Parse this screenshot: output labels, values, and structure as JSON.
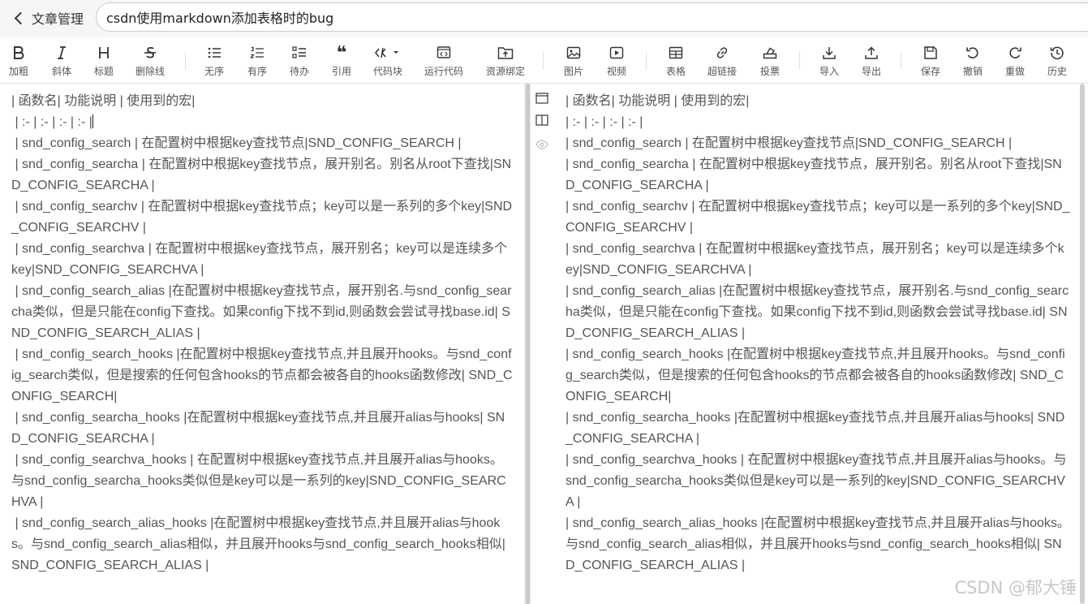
{
  "header": {
    "back_label": "文章管理",
    "title_value": "csdn使用markdown添加表格时的bug"
  },
  "toolbar": [
    {
      "icon": "bold-icon",
      "label": "加粗"
    },
    {
      "icon": "italic-icon",
      "label": "斜体"
    },
    {
      "icon": "heading-icon",
      "label": "标题"
    },
    {
      "icon": "strikethrough-icon",
      "label": "删除线"
    },
    {
      "icon": "unordered-list-icon",
      "label": "无序"
    },
    {
      "icon": "ordered-list-icon",
      "label": "有序"
    },
    {
      "icon": "todo-list-icon",
      "label": "待办"
    },
    {
      "icon": "quote-icon",
      "label": "引用"
    },
    {
      "icon": "code-block-icon",
      "label": "代码块"
    },
    {
      "icon": "run-code-icon",
      "label": "运行代码"
    },
    {
      "icon": "resource-bind-icon",
      "label": "资源绑定"
    },
    {
      "icon": "image-icon",
      "label": "图片"
    },
    {
      "icon": "video-icon",
      "label": "视频"
    },
    {
      "icon": "table-icon",
      "label": "表格"
    },
    {
      "icon": "link-icon",
      "label": "超链接"
    },
    {
      "icon": "vote-icon",
      "label": "投票"
    },
    {
      "icon": "import-icon",
      "label": "导入"
    },
    {
      "icon": "export-icon",
      "label": "导出"
    },
    {
      "icon": "save-icon",
      "label": "保存"
    },
    {
      "icon": "undo-icon",
      "label": "撤销"
    },
    {
      "icon": "redo-icon",
      "label": "重做"
    },
    {
      "icon": "history-icon",
      "label": "历史"
    }
  ],
  "editor_lines": [
    "| 函数名| 功能说明 | 使用到的宏|",
    " | :- | :- | :- | :- |",
    " | snd_config_search | 在配置树中根据key查找节点|SND_CONFIG_SEARCH |",
    " | snd_config_searcha | 在配置树中根据key查找节点，展开别名。别名从root下查找|SND_CONFIG_SEARCHA |",
    " | snd_config_searchv | 在配置树中根据key查找节点；key可以是一系列的多个key|SND_CONFIG_SEARCHV |",
    " | snd_config_searchva | 在配置树中根据key查找节点，展开别名；key可以是连续多个key|SND_CONFIG_SEARCHVA |",
    " | snd_config_search_alias |在配置树中根据key查找节点，展开别名.与snd_config_searcha类似，但是只能在config下查找。如果config下找不到id,则函数会尝试寻找base.id| SND_CONFIG_SEARCH_ALIAS |",
    " | snd_config_search_hooks |在配置树中根据key查找节点,并且展开hooks。与snd_config_search类似，但是搜索的任何包含hooks的节点都会被各自的hooks函数修改| SND_CONFIG_SEARCH|",
    " | snd_config_searcha_hooks |在配置树中根据key查找节点,并且展开alias与hooks| SND_CONFIG_SEARCHA |",
    " | snd_config_searchva_hooks | 在配置树中根据key查找节点,并且展开alias与hooks。与snd_config_searcha_hooks类似但是key可以是一系列的key|SND_CONFIG_SEARCHVA |",
    " | snd_config_search_alias_hooks |在配置树中根据key查找节点,并且展开alias与hooks。与snd_config_search_alias相似，并且展开hooks与snd_config_search_hooks相似| SND_CONFIG_SEARCH_ALIAS |"
  ],
  "preview_lines": [
    "| 函数名| 功能说明 | 使用到的宏|",
    "| :- | :- | :- | :- |",
    "| snd_config_search | 在配置树中根据key查找节点|SND_CONFIG_SEARCH |",
    "| snd_config_searcha | 在配置树中根据key查找节点，展开别名。别名从root下查找|SND_CONFIG_SEARCHA |",
    "| snd_config_searchv | 在配置树中根据key查找节点；key可以是一系列的多个key|SND_CONFIG_SEARCHV |",
    "| snd_config_searchva | 在配置树中根据key查找节点，展开别名；key可以是连续多个key|SND_CONFIG_SEARCHVA |",
    "| snd_config_search_alias |在配置树中根据key查找节点，展开别名.与snd_config_searcha类似，但是只能在config下查找。如果config下找不到id,则函数会尝试寻找base.id| SND_CONFIG_SEARCH_ALIAS |",
    "| snd_config_search_hooks |在配置树中根据key查找节点,并且展开hooks。与snd_config_search类似，但是搜索的任何包含hooks的节点都会被各自的hooks函数修改| SND_CONFIG_SEARCH|",
    "| snd_config_searcha_hooks |在配置树中根据key查找节点,并且展开alias与hooks| SND_CONFIG_SEARCHA |",
    "| snd_config_searchva_hooks | 在配置树中根据key查找节点,并且展开alias与hooks。与snd_config_searcha_hooks类似但是key可以是一系列的key|SND_CONFIG_SEARCHVA |",
    "| snd_config_search_alias_hooks |在配置树中根据key查找节点,并且展开alias与hooks。与snd_config_search_alias相似，并且展开hooks与snd_config_search_hooks相似| SND_CONFIG_SEARCH_ALIAS |"
  ],
  "watermark": "CSDN @郁大锤"
}
